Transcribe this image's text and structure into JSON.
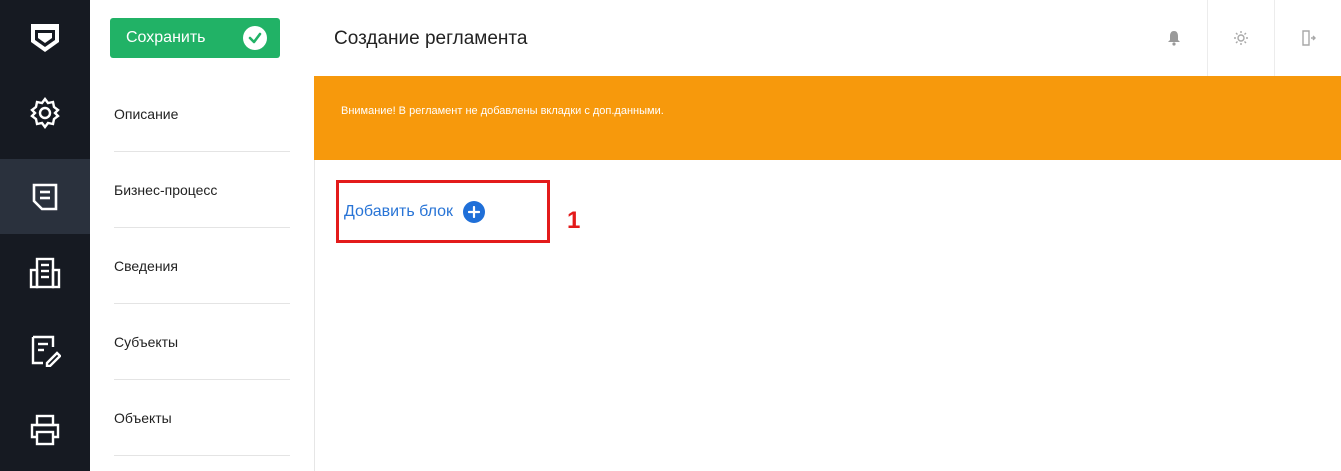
{
  "header": {
    "title": "Создание регламента"
  },
  "toolbar": {
    "save_label": "Сохранить"
  },
  "nav": {
    "items": [
      {
        "label": "Описание"
      },
      {
        "label": "Бизнес-процесс"
      },
      {
        "label": "Сведения"
      },
      {
        "label": "Субъекты"
      },
      {
        "label": "Объекты"
      }
    ]
  },
  "banner": {
    "text": "Внимание! В регламент не добавлены вкладки с доп.данными."
  },
  "main": {
    "add_block_label": "Добавить блок"
  },
  "annotation": {
    "marker": "1"
  },
  "rail": {
    "icons": [
      "logo-icon",
      "gear-icon",
      "document-icon",
      "building-icon",
      "edit-form-icon",
      "printer-icon"
    ]
  },
  "colors": {
    "rail": "#161a22",
    "save": "#21b266",
    "banner": "#f7990c",
    "link": "#2874d6",
    "highlight": "#e31b1b"
  }
}
